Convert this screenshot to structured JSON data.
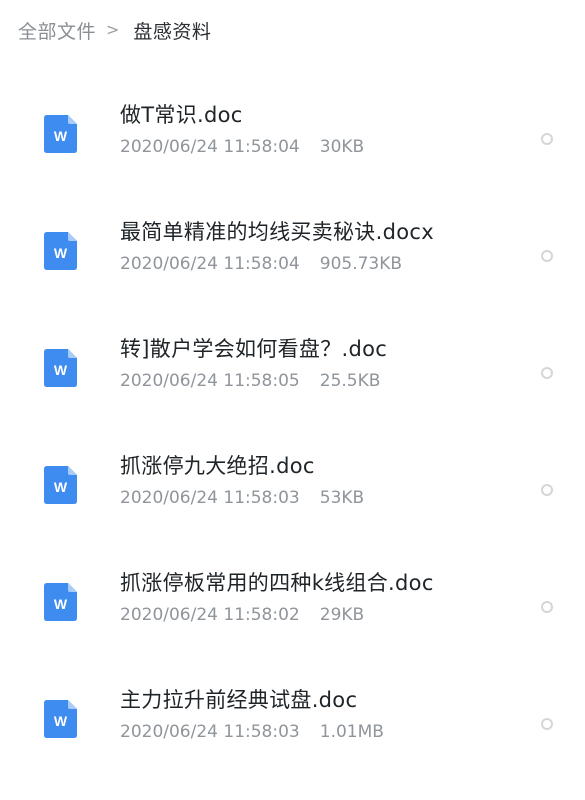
{
  "breadcrumb": {
    "root": "全部文件",
    "separator": ">",
    "current": "盘感资料"
  },
  "colors": {
    "word_icon_blue": "#3f8cf0",
    "word_icon_fold": "#a9cbf8"
  },
  "files": [
    {
      "name": "做T常识.doc",
      "date": "2020/06/24 11:58:04",
      "size": "30KB",
      "icon": "word-doc-icon"
    },
    {
      "name": "最简单精准的均线买卖秘诀.docx",
      "date": "2020/06/24 11:58:04",
      "size": "905.73KB",
      "icon": "word-doc-icon"
    },
    {
      "name": "转]散户学会如何看盘？.doc",
      "date": "2020/06/24 11:58:05",
      "size": "25.5KB",
      "icon": "word-doc-icon"
    },
    {
      "name": "抓涨停九大绝招.doc",
      "date": "2020/06/24 11:58:03",
      "size": "53KB",
      "icon": "word-doc-icon"
    },
    {
      "name": "抓涨停板常用的四种k线组合.doc",
      "date": "2020/06/24 11:58:02",
      "size": "29KB",
      "icon": "word-doc-icon"
    },
    {
      "name": "主力拉升前经典试盘.doc",
      "date": "2020/06/24 11:58:03",
      "size": "1.01MB",
      "icon": "word-doc-icon"
    }
  ]
}
